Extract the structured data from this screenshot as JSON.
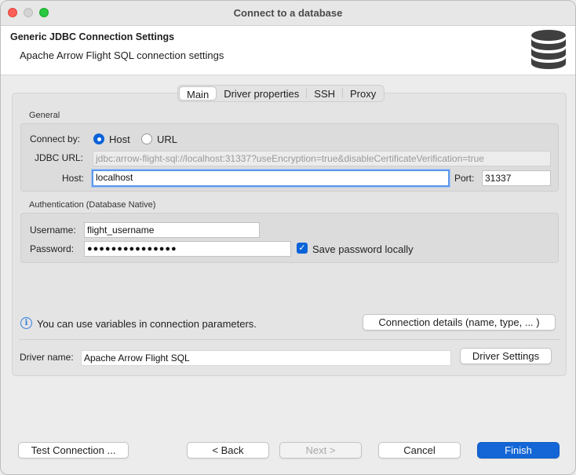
{
  "window": {
    "title": "Connect to a database"
  },
  "header": {
    "title": "Generic JDBC Connection Settings",
    "subtitle": "Apache Arrow Flight SQL connection settings"
  },
  "tabs": [
    {
      "label": "Main",
      "active": true
    },
    {
      "label": "Driver properties"
    },
    {
      "label": "SSH"
    },
    {
      "label": "Proxy"
    }
  ],
  "general": {
    "label": "General",
    "connect_by_label": "Connect by:",
    "option_host": "Host",
    "option_url": "URL",
    "selected": "Host",
    "jdbc_url_label": "JDBC URL:",
    "jdbc_url": "jdbc:arrow-flight-sql://localhost:31337?useEncryption=true&disableCertificateVerification=true",
    "host_label": "Host:",
    "host": "localhost",
    "port_label": "Port:",
    "port": "31337"
  },
  "auth": {
    "label": "Authentication (Database Native)",
    "username_label": "Username:",
    "username": "flight_username",
    "password_label": "Password:",
    "password_mask": "●●●●●●●●●●●●●●●",
    "save_password_label": "Save password locally",
    "save_password_checked": true
  },
  "info": {
    "text": "You can use variables in connection parameters.",
    "connection_details_button": "Connection details (name, type, ... )"
  },
  "driver": {
    "label": "Driver name:",
    "name": "Apache Arrow Flight SQL",
    "settings_button": "Driver Settings"
  },
  "footer": {
    "test_button": "Test Connection ...",
    "back_button": "< Back",
    "next_button": "Next >",
    "cancel_button": "Cancel",
    "finish_button": "Finish"
  },
  "colors": {
    "accent": "#1466d6",
    "focus": "#5c98eb"
  }
}
